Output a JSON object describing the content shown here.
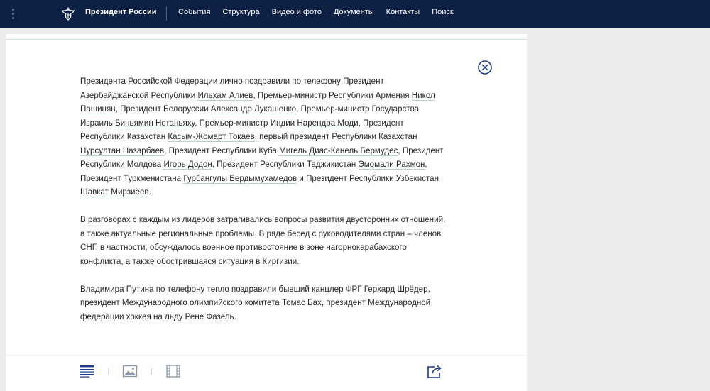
{
  "header": {
    "site_title": "Президент России",
    "nav": [
      "События",
      "Структура",
      "Видео и фото",
      "Документы",
      "Контакты",
      "Поиск"
    ]
  },
  "article": {
    "p1": [
      {
        "t": "Президента Российской Федерации лично поздравили по телефону Президент Азербайджанской Республики "
      },
      {
        "t": "Ильхам Алиев",
        "link": true
      },
      {
        "t": ", Премьер-министр Республики Армения "
      },
      {
        "t": "Никол Пашинян",
        "link": true
      },
      {
        "t": ", Президент Белоруссии "
      },
      {
        "t": "Александр Лукашенко",
        "link": true
      },
      {
        "t": ", Премьер-министр Государства Израиль "
      },
      {
        "t": "Биньямин Нетаньяху",
        "link": true
      },
      {
        "t": ", Премьер-министр Индии "
      },
      {
        "t": "Нарендра Моди",
        "link": true
      },
      {
        "t": ", Президент Республики Казахстан "
      },
      {
        "t": "Касым-Жомарт Токаев",
        "link": true
      },
      {
        "t": ", первый президент Республики Казахстан "
      },
      {
        "t": "Нурсултан Назарбаев",
        "link": true
      },
      {
        "t": ", Президент Республики Куба "
      },
      {
        "t": "Мигель Диас-Канель Бермудес",
        "link": true
      },
      {
        "t": ", Президент Республики Молдова "
      },
      {
        "t": "Игорь Додон",
        "link": true
      },
      {
        "t": ", Президент Республики Таджикистан "
      },
      {
        "t": "Эмомали Рахмон",
        "link": true
      },
      {
        "t": ", Президент Туркменистана "
      },
      {
        "t": "Гурбангулы Бердымухамедов",
        "link": true
      },
      {
        "t": " и Президент Республики Узбекистан "
      },
      {
        "t": "Шавкат Мирзиёев",
        "link": true
      },
      {
        "t": "."
      }
    ],
    "p2": [
      {
        "t": "В разговорах с каждым из лидеров затрагивались вопросы развития двусторонних отношений, а также актуальные региональные проблемы. В ряде бесед с руководителями стран – членов СНГ, в частности, обсуждалось военное противостояние в зоне нагорнокарабахского конфликта, а также обострившаяся ситуация в Киргизии."
      }
    ],
    "p3": [
      {
        "t": "Владимира Путина по телефону тепло поздравили бывший канцлер ФРГ Герхард Шрёдер, президент Международного олимпийского комитета Томас Бах, президент Международной федерации хоккея на льду Рене Фазель."
      }
    ]
  },
  "icons": {
    "menu": "menu-dots-icon",
    "emblem": "emblem-icon",
    "close": "close-icon",
    "text": "text-view-icon",
    "photo": "photo-icon",
    "video": "video-icon",
    "share": "share-icon"
  },
  "colors": {
    "header_bg": "#0c2044",
    "accent": "#1a3a8c",
    "link_underline": "#b5d3cd",
    "page_bg": "#ececec"
  }
}
